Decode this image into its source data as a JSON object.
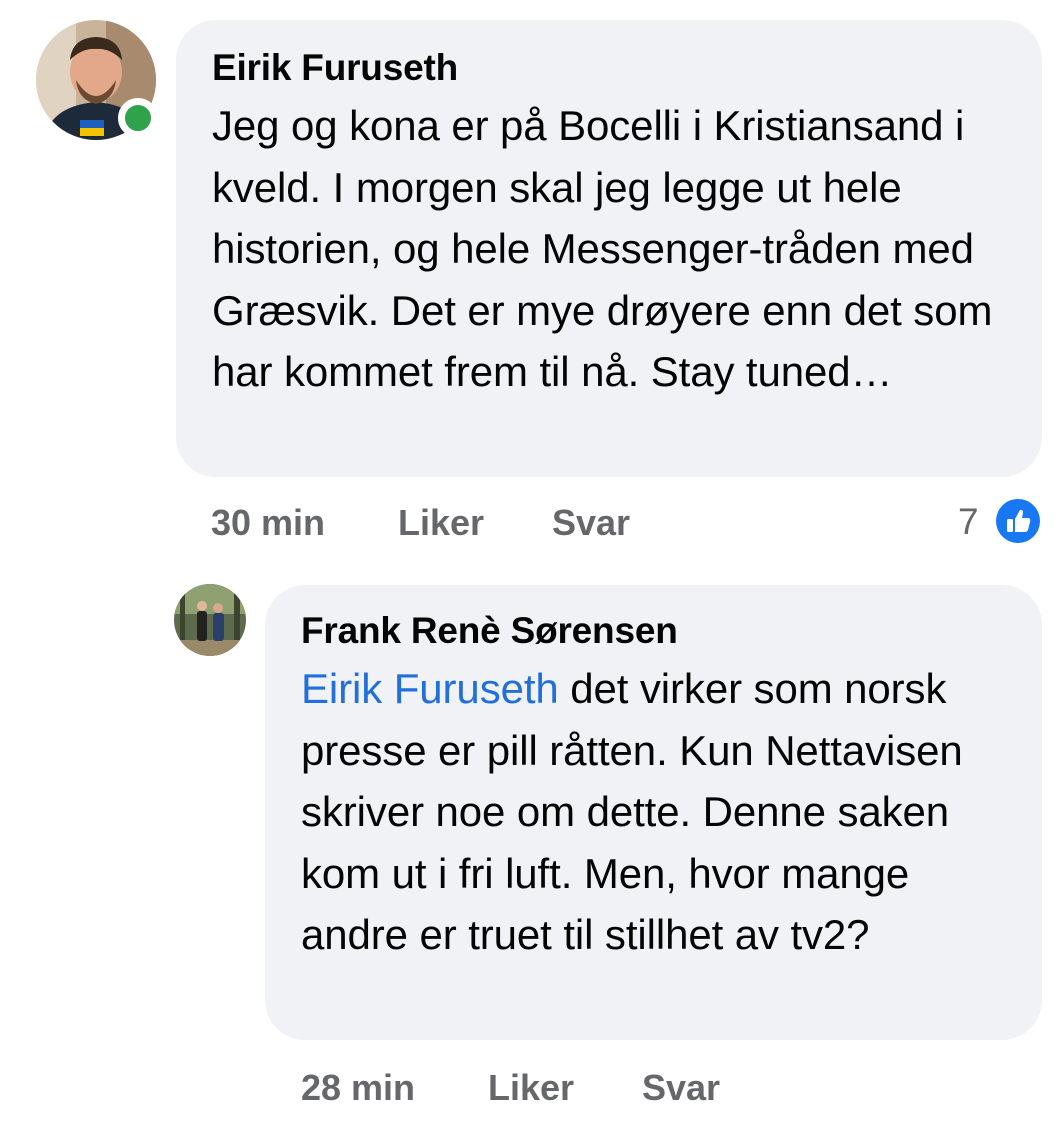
{
  "comments": [
    {
      "author": "Eirik Furuseth",
      "online": true,
      "text": "Jeg og kona er på Bocelli i Kristiansand i kveld. I morgen skal jeg legge ut hele historien, og hele Messenger-tråden med Græsvik. Det er mye drøyere enn det som har kommet frem til nå. Stay tuned…",
      "time": "30 min",
      "like_label": "Liker",
      "reply_label": "Svar",
      "reaction_count": "7",
      "reaction_icon": "thumbs-up-icon"
    },
    {
      "author": "Frank Renè Sørensen",
      "mention": "Eirik Furuseth",
      "text": " det virker som norsk presse er pill råtten. Kun Nettavisen skriver noe om dette. Denne saken kom ut i fri luft. Men, hvor mange andre er truet til stillhet av tv2?",
      "time": "28 min",
      "like_label": "Liker",
      "reply_label": "Svar"
    }
  ],
  "colors": {
    "bubble": "#f0f2f5",
    "meta_text": "#65676b",
    "mention": "#216fdb",
    "like_blue": "#1877f2",
    "online_green": "#31a24c"
  }
}
